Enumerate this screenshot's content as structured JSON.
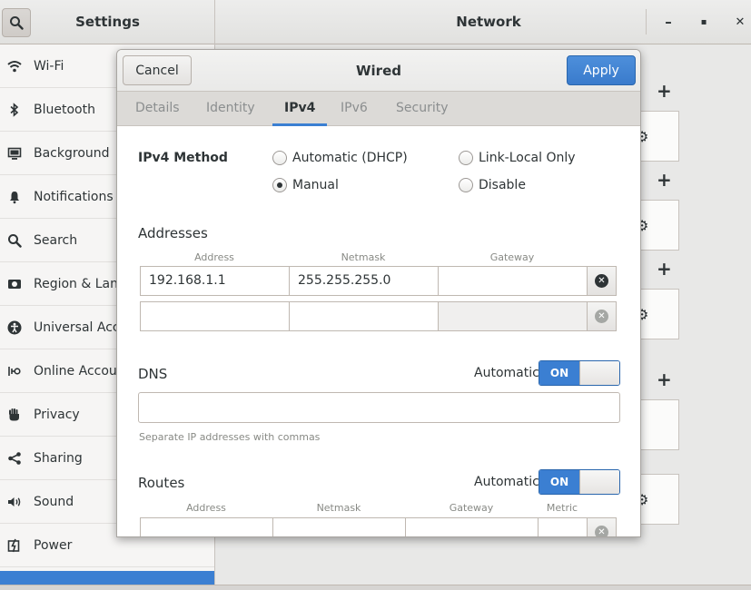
{
  "header": {
    "left_title": "Settings",
    "right_title": "Network",
    "minimize": "–",
    "maximize": "▪",
    "close": "✕"
  },
  "sidebar": {
    "items": [
      {
        "label": "Wi-Fi",
        "icon": "wifi-icon"
      },
      {
        "label": "Bluetooth",
        "icon": "bluetooth-icon"
      },
      {
        "label": "Background",
        "icon": "background-icon"
      },
      {
        "label": "Notifications",
        "icon": "bell-icon"
      },
      {
        "label": "Search",
        "icon": "search-icon"
      },
      {
        "label": "Region & Language",
        "icon": "region-icon"
      },
      {
        "label": "Universal Access",
        "icon": "accessibility-icon"
      },
      {
        "label": "Online Accounts",
        "icon": "online-accounts-icon"
      },
      {
        "label": "Privacy",
        "icon": "hand-icon"
      },
      {
        "label": "Sharing",
        "icon": "share-icon"
      },
      {
        "label": "Sound",
        "icon": "speaker-icon"
      },
      {
        "label": "Power",
        "icon": "power-icon"
      }
    ]
  },
  "background_pane": {
    "add_symbol": "+"
  },
  "dialog": {
    "title": "Wired",
    "cancel_label": "Cancel",
    "apply_label": "Apply",
    "tabs": [
      {
        "label": "Details",
        "active": false
      },
      {
        "label": "Identity",
        "active": false
      },
      {
        "label": "IPv4",
        "active": true
      },
      {
        "label": "IPv6",
        "active": false
      },
      {
        "label": "Security",
        "active": false
      }
    ],
    "ipv4_method": {
      "label": "IPv4 Method",
      "options": [
        {
          "label": "Automatic (DHCP)",
          "selected": false
        },
        {
          "label": "Link-Local Only",
          "selected": false
        },
        {
          "label": "Manual",
          "selected": true
        },
        {
          "label": "Disable",
          "selected": false
        }
      ]
    },
    "addresses": {
      "title": "Addresses",
      "columns": [
        "Address",
        "Netmask",
        "Gateway"
      ],
      "rows": [
        {
          "address": "192.168.1.1",
          "netmask": "255.255.255.0",
          "gateway": ""
        },
        {
          "address": "",
          "netmask": "",
          "gateway": ""
        }
      ]
    },
    "dns": {
      "title": "DNS",
      "automatic_label": "Automatic",
      "switch_label": "ON",
      "automatic_on": true,
      "value": "",
      "hint": "Separate IP addresses with commas"
    },
    "routes": {
      "title": "Routes",
      "automatic_label": "Automatic",
      "switch_label": "ON",
      "automatic_on": true,
      "columns": [
        "Address",
        "Netmask",
        "Gateway",
        "Metric"
      ]
    }
  },
  "colors": {
    "accent": "#3b7fd2",
    "sidebar_bg": "#f6f5f4",
    "dialog_bg": "#ffffff"
  }
}
